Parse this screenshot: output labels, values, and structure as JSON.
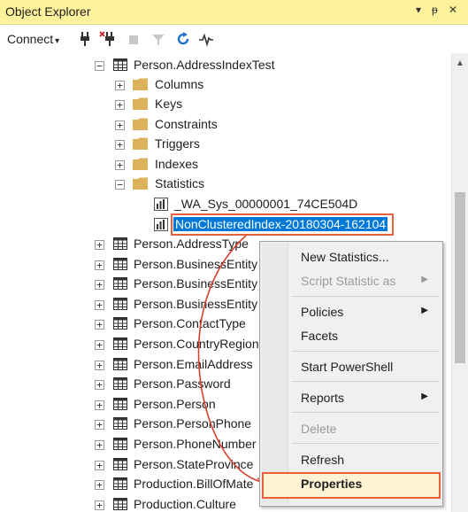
{
  "window": {
    "title": "Object Explorer",
    "dropdown_glyph": "▾",
    "pin_glyph": "ᵽ",
    "close_glyph": "✕"
  },
  "toolbar": {
    "connect_label": "Connect",
    "connect_caret": "▾"
  },
  "tree": {
    "table_node": "Person.AddressIndexTest",
    "folders": [
      {
        "label": "Columns",
        "expander": "+"
      },
      {
        "label": "Keys",
        "expander": "+"
      },
      {
        "label": "Constraints",
        "expander": "+"
      },
      {
        "label": "Triggers",
        "expander": "+"
      },
      {
        "label": "Indexes",
        "expander": "+"
      },
      {
        "label": "Statistics",
        "expander": "−"
      }
    ],
    "table_expander": "−",
    "statistics": [
      {
        "label": "_WA_Sys_00000001_74CE504D"
      },
      {
        "label": "NonClusteredIndex-20180304-162104",
        "selected": true
      }
    ],
    "tables": [
      "Person.AddressType",
      "Person.BusinessEntity",
      "Person.BusinessEntity",
      "Person.BusinessEntity",
      "Person.ContactType",
      "Person.CountryRegion",
      "Person.EmailAddress",
      "Person.Password",
      "Person.Person",
      "Person.PersonPhone",
      "Person.PhoneNumber",
      "Person.StateProvince",
      "Production.BillOfMate",
      "Production.Culture"
    ],
    "collapsed_expander": "+"
  },
  "context_menu": {
    "items": [
      {
        "label": "New Statistics...",
        "disabled": false,
        "submenu": false
      },
      {
        "label": "Script Statistic as",
        "disabled": true,
        "submenu": true
      },
      {
        "label": "Policies",
        "disabled": false,
        "submenu": true
      },
      {
        "label": "Facets",
        "disabled": false,
        "submenu": false
      },
      {
        "label": "Start PowerShell",
        "disabled": false,
        "submenu": false
      },
      {
        "label": "Reports",
        "disabled": false,
        "submenu": true
      },
      {
        "label": "Delete",
        "disabled": true,
        "submenu": false
      },
      {
        "label": "Refresh",
        "disabled": false,
        "submenu": false
      },
      {
        "label": "Properties",
        "disabled": false,
        "submenu": false,
        "highlighted": true
      }
    ],
    "submenu_glyph": "▶"
  },
  "scrollbar": {
    "up_glyph": "▲"
  },
  "colors": {
    "titlebar_bg": "#fff29d",
    "selection": "#0078d7",
    "annotation": "#e8603c",
    "folder": "#dcb35c"
  }
}
